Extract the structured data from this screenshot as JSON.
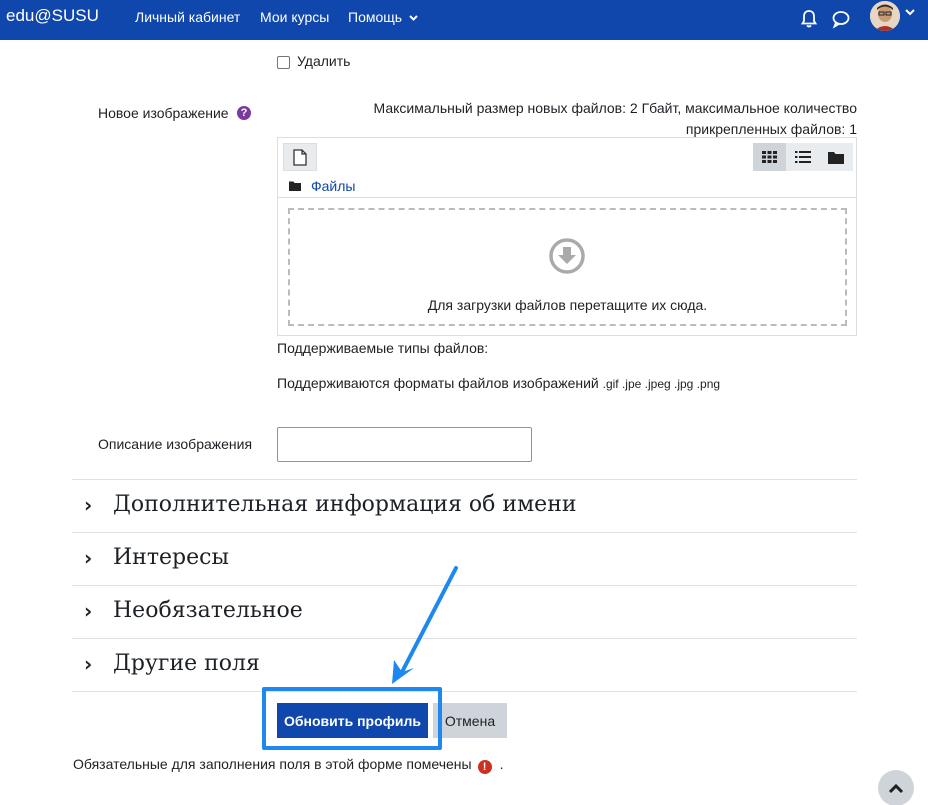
{
  "navbar": {
    "brand": "edu@SUSU",
    "links": [
      "Личный кабинет",
      "Мои курсы",
      "Помощь"
    ],
    "colors": {
      "background": "#0f47ad",
      "text": "#ffffff"
    },
    "icons": [
      "bell-icon",
      "chat-icon",
      "avatar",
      "chevron-down-icon"
    ]
  },
  "form": {
    "delete_checkbox_label": "Удалить",
    "new_image_label": "Новое изображение",
    "max_size_line1": "Максимальный размер новых файлов: 2 Гбайт, максимальное количество",
    "max_size_line2": "прикрепленных файлов: 1",
    "filemanager": {
      "path_label": "Файлы",
      "dropzone_text": "Для загрузки файлов перетащите их сюда.",
      "views": [
        "grid-icon",
        "list-icon",
        "folder-icon"
      ]
    },
    "supported_types_label": "Поддерживаемые типы файлов:",
    "supported_formats_text": "Поддерживаются форматы файлов изображений",
    "supported_formats_ext": ".gif .jpe .jpeg .jpg .png",
    "image_description_label": "Описание изображения",
    "image_description_value": ""
  },
  "sections": [
    "Дополнительная информация об имени",
    "Интересы",
    "Необязательное",
    "Другие поля"
  ],
  "buttons": {
    "submit": "Обновить профиль",
    "cancel": "Отмена"
  },
  "footer": {
    "required_note": "Обязательные для заполнения поля в этой форме помечены",
    "required_dot": "."
  },
  "annotation": {
    "color": "#1e88f0"
  }
}
